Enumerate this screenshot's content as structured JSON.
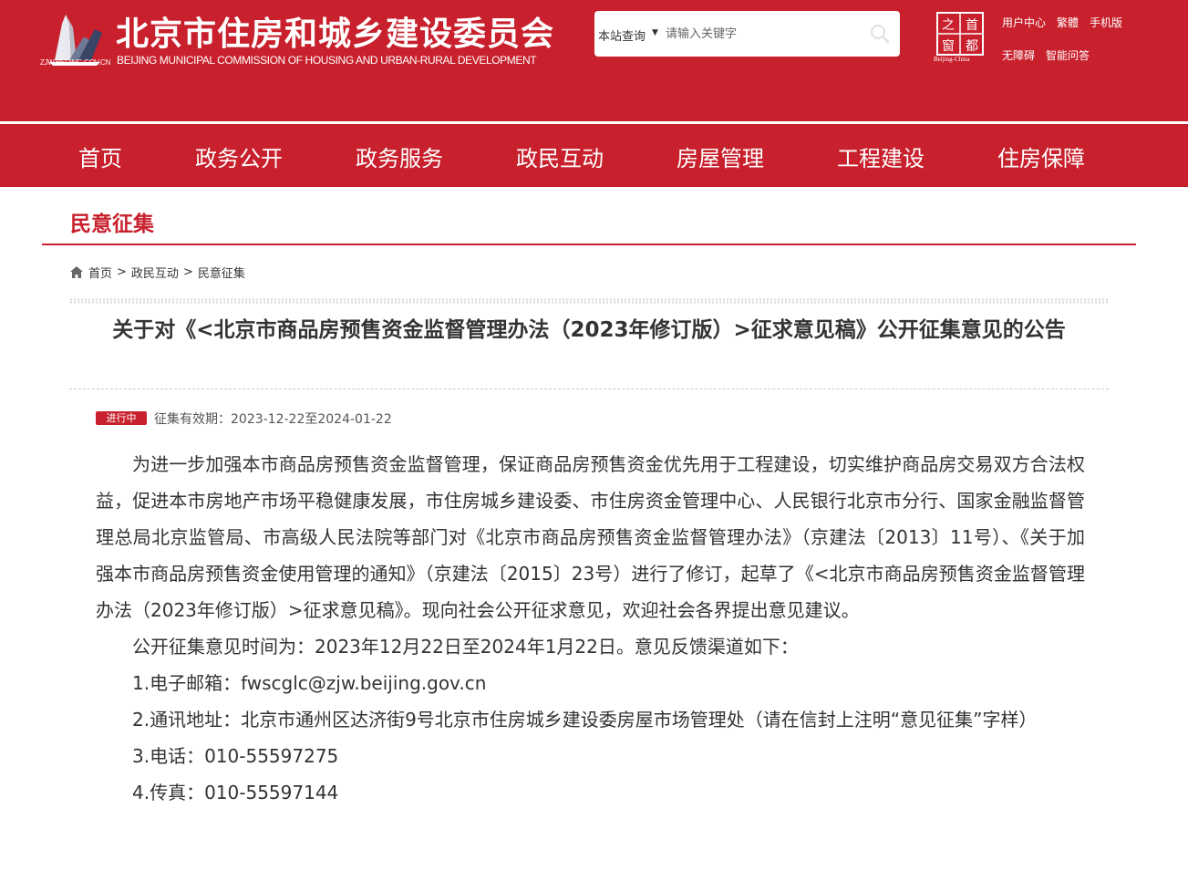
{
  "header": {
    "logo_url": "ZJW.BEIJING.GOV.CN",
    "site_title": "北京市住房和城乡建设委员会",
    "site_subtitle": "BEIJING MUNICIPAL COMMISSION OF HOUSING AND URBAN-RURAL DEVELOPMENT",
    "search": {
      "scope": "本站查询",
      "placeholder": "请输入关键字",
      "icon": "search-icon"
    },
    "capital_logo": {
      "chars": [
        "之",
        "首",
        "窗",
        "都"
      ],
      "caption": "Beijing-China"
    },
    "top_links": [
      "用户中心",
      "繁體",
      "手机版",
      "无障碍",
      "智能问答"
    ]
  },
  "nav": {
    "items": [
      "首页",
      "政务公开",
      "政务服务",
      "政民互动",
      "房屋管理",
      "工程建设",
      "住房保障"
    ]
  },
  "section": {
    "title": "民意征集"
  },
  "breadcrumb": {
    "icon": "home-icon",
    "items": [
      "首页",
      "政民互动",
      "民意征集"
    ],
    "separator": ">"
  },
  "article": {
    "title": "关于对《<北京市商品房预售资金监督管理办法（2023年修订版）>征求意见稿》公开征集意见的公告",
    "status": "进行中",
    "validity": "征集有效期：2023-12-22至2024-01-22",
    "paragraphs": [
      "为进一步加强本市商品房预售资金监督管理，保证商品房预售资金优先用于工程建设，切实维护商品房交易双方合法权益，促进本市房地产市场平稳健康发展，市住房城乡建设委、市住房资金管理中心、人民银行北京市分行、国家金融监督管理总局北京监管局、市高级人民法院等部门对《北京市商品房预售资金监督管理办法》（京建法〔2013〕11号）、《关于加强本市商品房预售资金使用管理的通知》（京建法〔2015〕23号）进行了修订，起草了《<北京市商品房预售资金监督管理办法（2023年修订版）>征求意见稿》。现向社会公开征求意见，欢迎社会各界提出意见建议。",
      "公开征集意见时间为：2023年12月22日至2024年1月22日。意见反馈渠道如下：",
      "1.电子邮箱：fwscglc@zjw.beijing.gov.cn",
      "2.通讯地址：北京市通州区达济街9号北京市住房城乡建设委房屋市场管理处（请在信封上注明“意见征集”字样）",
      "3.电话：010-55597275",
      "4.传真：010-55597144"
    ]
  },
  "colors": {
    "brand_red": "#c8202c",
    "text": "#333333"
  }
}
